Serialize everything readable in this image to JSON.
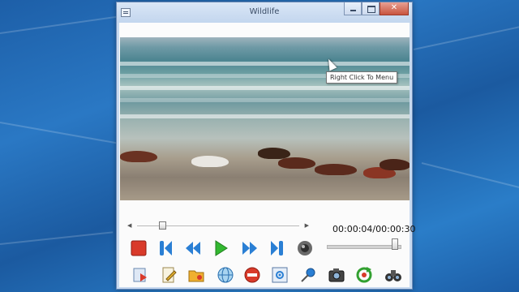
{
  "window": {
    "title": "Wildlife"
  },
  "video": {
    "tooltip": "Right Click To Menu"
  },
  "playback": {
    "time_display": "00:00:04/00:00:30",
    "seek_position": 0.17,
    "volume_level": 0.95
  },
  "controls": [
    {
      "name": "stop-icon",
      "color": "#d93a2a"
    },
    {
      "name": "skip-previous-icon",
      "color": "#2a7fd4"
    },
    {
      "name": "rewind-icon",
      "color": "#2a7fd4"
    },
    {
      "name": "play-icon",
      "color": "#32b830"
    },
    {
      "name": "fast-forward-icon",
      "color": "#2a7fd4"
    },
    {
      "name": "skip-next-icon",
      "color": "#2a7fd4"
    },
    {
      "name": "speaker-icon",
      "color": "#555555"
    }
  ],
  "toolbar": [
    {
      "name": "import-icon",
      "color": "#2a7fd4"
    },
    {
      "name": "document-edit-icon",
      "color": "#e0b030"
    },
    {
      "name": "open-folder-icon",
      "color": "#f0b030"
    },
    {
      "name": "globe-icon",
      "color": "#3a90d0"
    },
    {
      "name": "no-entry-icon",
      "color": "#d93a2a"
    },
    {
      "name": "target-icon",
      "color": "#2a7fd4"
    },
    {
      "name": "pin-icon",
      "color": "#2a7fd4"
    },
    {
      "name": "camera-icon",
      "color": "#444444"
    },
    {
      "name": "refresh-icon",
      "color": "#32a030"
    },
    {
      "name": "binoculars-icon",
      "color": "#333333"
    }
  ]
}
